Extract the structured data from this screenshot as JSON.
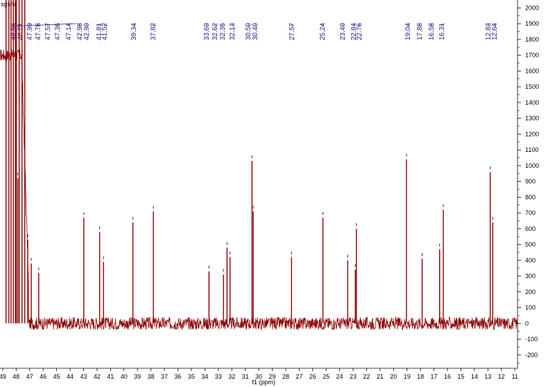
{
  "sample_label": "sgsfe",
  "chart_data": {
    "type": "line",
    "xlabel": "f1 (ppm)",
    "ylabel": "",
    "x_reversed": true,
    "xlim": [
      49.2,
      10.8
    ],
    "ylim": [
      -280,
      2050
    ],
    "xticks": [
      49,
      48,
      47,
      46,
      45,
      44,
      43,
      42,
      41,
      40,
      39,
      38,
      37,
      36,
      35,
      34,
      33,
      32,
      31,
      30,
      29,
      28,
      27,
      26,
      25,
      24,
      23,
      22,
      21,
      20,
      19,
      18,
      17,
      16,
      15,
      14,
      13,
      12,
      11
    ],
    "yticks": [
      -200,
      -100,
      0,
      100,
      200,
      300,
      400,
      500,
      600,
      700,
      800,
      900,
      1000,
      1100,
      1200,
      1300,
      1400,
      1500,
      1600,
      1700,
      1800,
      1900,
      2000
    ],
    "grid": false,
    "line_color": "#8b0000",
    "label_color": "#1f1f8f",
    "peak_labels": [
      "48.54",
      "48.21",
      "47.99",
      "47.78",
      "47.57",
      "47.36",
      "47.14",
      "42.98",
      "42.90",
      "41.81",
      "41.52",
      "39.34",
      "37.82",
      "33.69",
      "32.62",
      "32.35",
      "32.13",
      "30.50",
      "30.40",
      "27.57",
      "25.24",
      "23.40",
      "22.84",
      "22.76",
      "19.04",
      "17.88",
      "16.58",
      "16.31",
      "12.83",
      "12.64"
    ],
    "series": [
      {
        "points": [
          {
            "x": 48.75,
            "y": 2050
          },
          {
            "x": 48.54,
            "y": 2050
          },
          {
            "x": 48.38,
            "y": 2050
          },
          {
            "x": 48.21,
            "y": 2050
          },
          {
            "x": 48.05,
            "y": 2050
          },
          {
            "x": 47.99,
            "y": 2050
          },
          {
            "x": 47.88,
            "y": 920
          },
          {
            "x": 47.78,
            "y": 2050
          },
          {
            "x": 47.57,
            "y": 2050
          },
          {
            "x": 47.36,
            "y": 2050
          },
          {
            "x": 47.14,
            "y": 530
          },
          {
            "x": 46.88,
            "y": 380
          },
          {
            "x": 46.33,
            "y": 320
          },
          {
            "x": 42.98,
            "y": 670
          },
          {
            "x": 41.81,
            "y": 580
          },
          {
            "x": 41.52,
            "y": 390
          },
          {
            "x": 39.34,
            "y": 640
          },
          {
            "x": 37.82,
            "y": 710
          },
          {
            "x": 33.69,
            "y": 330
          },
          {
            "x": 32.62,
            "y": 310
          },
          {
            "x": 32.35,
            "y": 480
          },
          {
            "x": 32.13,
            "y": 420
          },
          {
            "x": 30.5,
            "y": 1030
          },
          {
            "x": 30.4,
            "y": 710
          },
          {
            "x": 27.57,
            "y": 420
          },
          {
            "x": 25.24,
            "y": 670
          },
          {
            "x": 23.4,
            "y": 400
          },
          {
            "x": 22.84,
            "y": 340
          },
          {
            "x": 22.76,
            "y": 600
          },
          {
            "x": 19.04,
            "y": 1040
          },
          {
            "x": 17.88,
            "y": 410
          },
          {
            "x": 16.58,
            "y": 470
          },
          {
            "x": 16.31,
            "y": 720
          },
          {
            "x": 12.83,
            "y": 960
          },
          {
            "x": 12.64,
            "y": 640
          }
        ]
      }
    ]
  }
}
